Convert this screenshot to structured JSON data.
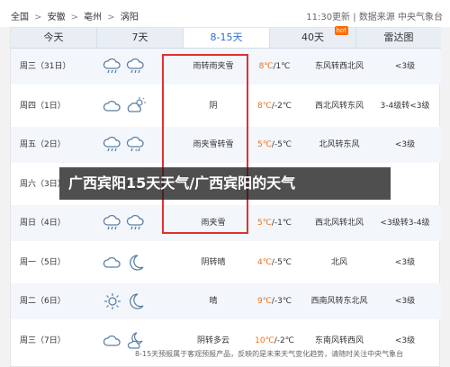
{
  "breadcrumb": [
    "全国",
    "安徽",
    "亳州",
    "涡阳"
  ],
  "update": {
    "time": "11:30更新",
    "divider": "|",
    "source": "数据来源 中央气象台"
  },
  "tabs": [
    {
      "label": "今天"
    },
    {
      "label": "7天"
    },
    {
      "label": "8-15天"
    },
    {
      "label": "40天",
      "badge": "hot"
    },
    {
      "label": "雷达图"
    }
  ],
  "rows": [
    {
      "day": "周三（31日）",
      "icon1": "cloud-rain-icon",
      "icon2": "cloud-rain-icon",
      "desc": "雨转雨夹雪",
      "hi": "8℃",
      "lo": "/1℃",
      "wind": "东风转西北风",
      "level": "<3级"
    },
    {
      "day": "周四（1日）",
      "icon1": "cloud-icon",
      "icon2": "cloud-sun-icon",
      "desc": "阴",
      "hi": "8℃",
      "lo": "/-2℃",
      "wind": "西北风转东风",
      "level": "3-4级转<3级"
    },
    {
      "day": "周五（2日）",
      "icon1": "cloud-rain-icon",
      "icon2": "cloud-sleet-icon",
      "desc": "雨夹雪转雪",
      "hi": "5℃",
      "lo": "/-5℃",
      "wind": "北风转东风",
      "level": "<3级"
    },
    {
      "day": "周六（3日）",
      "icon1": "cloud-icon",
      "icon2": "cloud-icon",
      "desc": "",
      "hi": "",
      "lo": "",
      "wind": "",
      "level": ""
    },
    {
      "day": "周日（4日）",
      "icon1": "cloud-rain-icon",
      "icon2": "cloud-rain-icon",
      "desc": "雨夹雪",
      "hi": "5℃",
      "lo": "/-1℃",
      "wind": "西北风转北风",
      "level": "<3级转3-4级"
    },
    {
      "day": "周一（5日）",
      "icon1": "cloud-icon",
      "icon2": "moon-icon",
      "desc": "阴转晴",
      "hi": "4℃",
      "lo": "/-5℃",
      "wind": "北风",
      "level": "<3级"
    },
    {
      "day": "周二（6日）",
      "icon1": "sun-icon",
      "icon2": "moon-icon",
      "desc": "晴",
      "hi": "9℃",
      "lo": "/-3℃",
      "wind": "西南风转东北风",
      "level": "<3级"
    },
    {
      "day": "周三（7日）",
      "icon1": "cloud-icon",
      "icon2": "moon-cloud-icon",
      "desc": "阴转多云",
      "hi": "10℃",
      "lo": "/-2℃",
      "wind": "东南风转西风",
      "level": "<3级"
    }
  ],
  "banner": "广西宾阳15天天气/广西宾阳的天气",
  "note": "8-15天预报属于客观预报产品，反映的是未来天气变化趋势，请随时关注中央气象台",
  "colors": {
    "accent": "#2a6fd6",
    "hi_temp": "#ef6f18",
    "highlight": "#e0302f"
  }
}
